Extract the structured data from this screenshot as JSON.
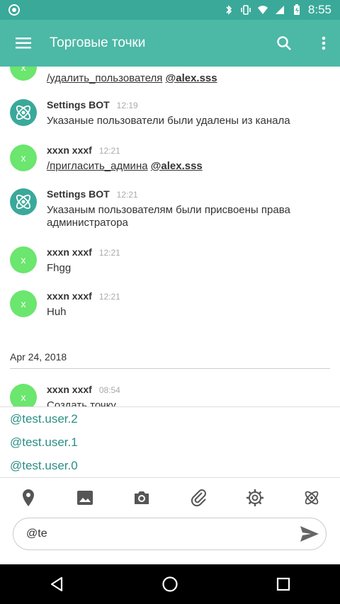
{
  "status_bar": {
    "time": "8:55"
  },
  "toolbar": {
    "title": "Торговые точки"
  },
  "messages": [
    {
      "avatar_letter": "x",
      "text_parts": {
        "command": "/удалить_пользователя",
        "mention": "@alex.sss"
      }
    },
    {
      "name": "Settings BOT",
      "time": "12:19",
      "text": "Указаные пользователи были удалены из канала"
    },
    {
      "avatar_letter": "x",
      "name": "xxxn xxxf",
      "time": "12:21",
      "text_parts": {
        "command": "/пригласить_админа",
        "mention": "@alex.sss"
      }
    },
    {
      "name": "Settings BOT",
      "time": "12:21",
      "text": "Указаным пользователям были присвоены права администратора"
    },
    {
      "avatar_letter": "x",
      "name": "xxxn xxxf",
      "time": "12:21",
      "text": "Fhgg"
    },
    {
      "avatar_letter": "x",
      "name": "xxxn xxxf",
      "time": "12:21",
      "text": "Huh"
    },
    {
      "avatar_letter": "x",
      "name": "xxxn xxxf",
      "time": "08:54",
      "text": "Создать точку"
    }
  ],
  "date_separator": "Apr 24, 2018",
  "suggestions": [
    "@test.user.2",
    "@test.user.1",
    "@test.user.0"
  ],
  "attach_icons": [
    "location-icon",
    "image-icon",
    "camera-icon",
    "attachment-icon",
    "settings-icon",
    "atom-icon"
  ],
  "input": {
    "value": "@te"
  },
  "colors": {
    "status_bar": "#3aa99a",
    "toolbar": "#4cb8a6",
    "avatar_user": "#6be66e",
    "mention_link": "#2a8f86"
  }
}
